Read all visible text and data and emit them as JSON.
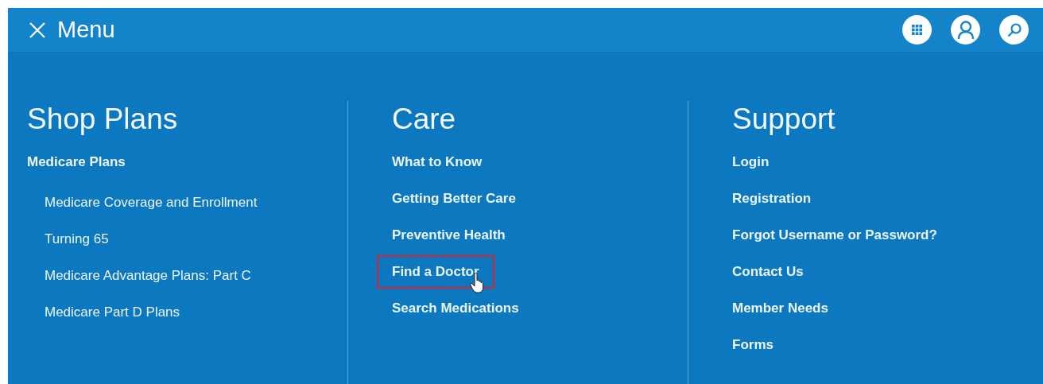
{
  "header": {
    "title": "Menu"
  },
  "columns": [
    {
      "heading": "Shop Plans",
      "items": [
        {
          "label": "Medicare Plans",
          "kind": "section",
          "highlighted": false
        },
        {
          "label": "Medicare Coverage and Enrollment",
          "kind": "sub",
          "highlighted": false
        },
        {
          "label": "Turning 65",
          "kind": "sub",
          "highlighted": false
        },
        {
          "label": "Medicare Advantage Plans: Part C",
          "kind": "sub",
          "highlighted": false
        },
        {
          "label": "Medicare Part D Plans",
          "kind": "sub",
          "highlighted": false
        }
      ]
    },
    {
      "heading": "Care",
      "items": [
        {
          "label": "What to Know",
          "kind": "section",
          "highlighted": false
        },
        {
          "label": "Getting Better Care",
          "kind": "section",
          "highlighted": false
        },
        {
          "label": "Preventive Health",
          "kind": "section",
          "highlighted": false
        },
        {
          "label": "Find a Doctor",
          "kind": "section",
          "highlighted": true
        },
        {
          "label": "Search Medications",
          "kind": "section",
          "highlighted": false
        }
      ]
    },
    {
      "heading": "Support",
      "items": [
        {
          "label": "Login",
          "kind": "section",
          "highlighted": false
        },
        {
          "label": "Registration",
          "kind": "section",
          "highlighted": false
        },
        {
          "label": "Forgot Username or Password?",
          "kind": "section",
          "highlighted": false
        },
        {
          "label": "Contact Us",
          "kind": "section",
          "highlighted": false
        },
        {
          "label": "Member Needs",
          "kind": "section",
          "highlighted": false
        },
        {
          "label": "Forms",
          "kind": "section",
          "highlighted": false
        }
      ]
    }
  ]
}
